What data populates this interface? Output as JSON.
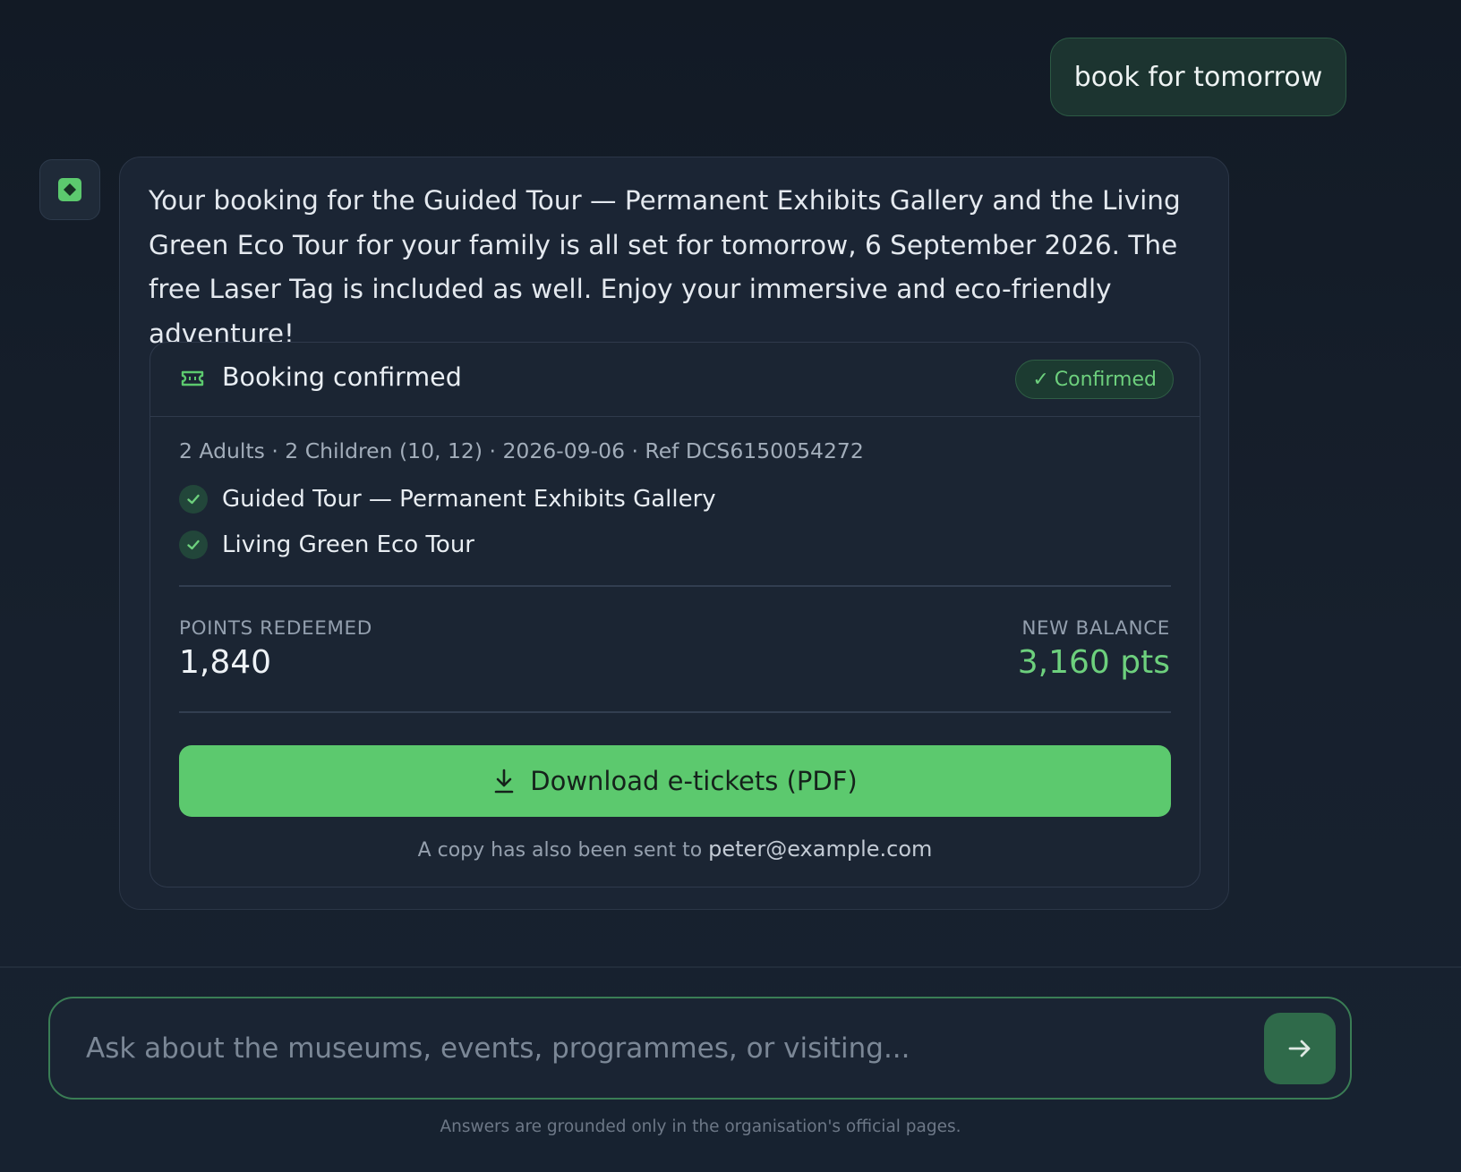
{
  "conversation": {
    "user_message": "book for tomorrow",
    "assistant_message": "Your booking for the Guided Tour — Permanent Exhibits Gallery and the Living Green Eco Tour for your family is all set for tomorrow, 6 September 2026. The free Laser Tag is included as well. Enjoy your immersive and eco-friendly adventure!"
  },
  "booking": {
    "icon": "ticket-icon",
    "title": "Booking confirmed",
    "status_badge": "Confirmed",
    "status_check": "✓",
    "meta": "2 Adults · 2 Children (10, 12) · 2026-09-06 · Ref DCS6150054272",
    "items": [
      {
        "label": "Guided Tour — Permanent Exhibits Gallery",
        "icon": "check-circle-icon"
      },
      {
        "label": "Living Green Eco Tour",
        "icon": "check-circle-icon"
      }
    ],
    "points_redeemed_label": "POINTS REDEEMED",
    "points_redeemed_value": "1,840",
    "new_balance_label": "NEW BALANCE",
    "new_balance_value": "3,160 pts",
    "download_label": "Download e-tickets (PDF)",
    "download_icon": "download-icon",
    "copy_note": "A copy has also been sent to",
    "email": "peter@example.com"
  },
  "composer": {
    "placeholder": "Ask about the museums, events, programmes, or visiting...",
    "value": "",
    "send_icon": "arrow-right-icon",
    "footnote": "Answers are grounded only in the organisation's official pages."
  },
  "colors": {
    "background": "#141c27",
    "accent_green": "#5cc96e",
    "balance_green": "#6dd07d",
    "card_bg": "#1b2533"
  }
}
